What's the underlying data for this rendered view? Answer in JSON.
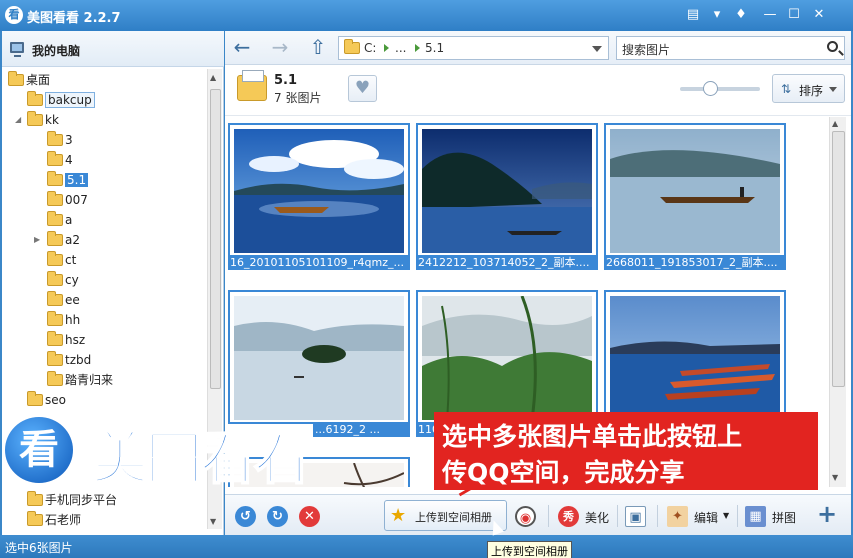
{
  "app": {
    "logo_char": "看",
    "title": "美图看看 2.2.7"
  },
  "window_controls": {
    "feedback": "▤",
    "menu": "▾",
    "skin": "♦",
    "minimize": "—",
    "maximize": "☐",
    "close": "✕"
  },
  "sidebar": {
    "root_label": "我的电脑",
    "tree": [
      {
        "label": "桌面",
        "level": 0,
        "expanded": true
      },
      {
        "label": "bakcup",
        "level": 1
      },
      {
        "label": "kk",
        "level": 1,
        "expanded": true
      },
      {
        "label": "3",
        "level": 2
      },
      {
        "label": "4",
        "level": 2
      },
      {
        "label": "5.1",
        "level": 2,
        "selected": true
      },
      {
        "label": "007",
        "level": 2
      },
      {
        "label": "a",
        "level": 2
      },
      {
        "label": "a2",
        "level": 2,
        "collapsed": true
      },
      {
        "label": "ct",
        "level": 2
      },
      {
        "label": "cy",
        "level": 2
      },
      {
        "label": "ee",
        "level": 2
      },
      {
        "label": "hh",
        "level": 2
      },
      {
        "label": "hsz",
        "level": 2
      },
      {
        "label": "tzbd",
        "level": 2
      },
      {
        "label": "踏青归来",
        "level": 2
      },
      {
        "label": "seo",
        "level": 1
      },
      {
        "label": "手机同步平台",
        "level": 1
      },
      {
        "label": "石老师",
        "level": 1
      }
    ]
  },
  "toolbar": {
    "back_icon": "arrow-left",
    "forward_icon": "arrow-right",
    "up_icon": "upload",
    "address": {
      "drive": "C:",
      "ellipsis": "...",
      "current": "5.1"
    },
    "search_placeholder": "搜索图片"
  },
  "folder_info": {
    "name": "5.1",
    "count": "7 张图片",
    "sort_label": "排序"
  },
  "thumbnails": [
    {
      "caption": "16_20101105101109_r4qmz_...",
      "scene": "lake-boat-clouds"
    },
    {
      "caption": "2412212_103714052_2_副本....",
      "scene": "dark-lake-hill"
    },
    {
      "caption": "2668011_191853017_2_副本....",
      "scene": "misty-lake-fisherman"
    },
    {
      "caption": "...6192_2 ...",
      "scene": "lake-island"
    },
    {
      "caption": "110...",
      "scene": "bamboo-fog"
    },
    {
      "caption": "",
      "scene": "boats-dusk"
    }
  ],
  "bottom_toolbar": {
    "upload_label": "上传到空间相册",
    "beautify_label": "美化",
    "edit_label": "编辑",
    "collage_label": "拼图",
    "add_symbol": "+"
  },
  "status": {
    "text": "选中6张图片",
    "tooltip": "上传到空间相册"
  },
  "overlay": {
    "banner_line1": "选中多张图片单击此按钮上",
    "banner_line2": "传QQ空间，完成分享",
    "watermark_logo": "看",
    "watermark_text": "美图看看"
  },
  "colors": {
    "accent": "#3a88d6",
    "banner": "#e22420",
    "titlebar": "#2f7fc6"
  }
}
